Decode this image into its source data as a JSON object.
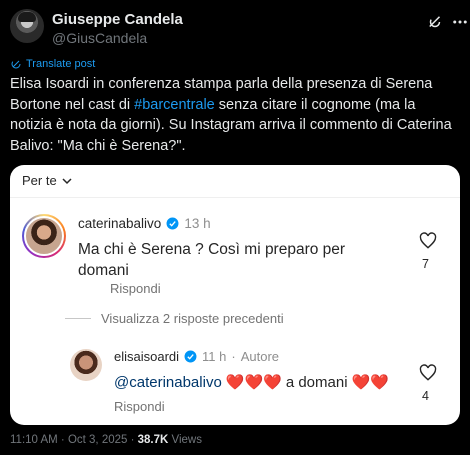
{
  "author": {
    "name": "Giuseppe Candela",
    "handle": "@GiusCandela"
  },
  "translate_label": "Translate post",
  "tweet": {
    "part1": "Elisa Isoardi in conferenza stampa parla della presenza di Serena Bortone nel cast di ",
    "hashtag": "#barcentrale",
    "part2": " senza citare il cognome (ma la notizia è nota da giorni). Su Instagram arriva il commento di Caterina Balivo: \"Ma chi è Serena?\"."
  },
  "card": {
    "sort_label": "Per te",
    "comment": {
      "username": "caterinabalivo",
      "time": "13 h",
      "text": "Ma chi è Serena ? Così mi preparo per domani",
      "reply_label": "Rispondi",
      "likes": "7"
    },
    "view_replies": "Visualizza 2 risposte precedenti",
    "reply": {
      "username": "elisaisoardi",
      "time": "11 h",
      "separator": "·",
      "author_badge": "Autore",
      "mention": "@caterinabalivo",
      "hearts": "❤️❤️❤️",
      "text": "a domani",
      "hearts_end": "❤️❤️",
      "reply_label": "Rispondi",
      "likes": "4"
    }
  },
  "meta": {
    "time_date": "11:10 AM · Oct 3, 2025 · ",
    "views": "38.7K",
    "views_label": " Views"
  },
  "colors": {
    "link": "#1d9bf0",
    "verified": "#0095f6",
    "heart": "#ed4956"
  }
}
